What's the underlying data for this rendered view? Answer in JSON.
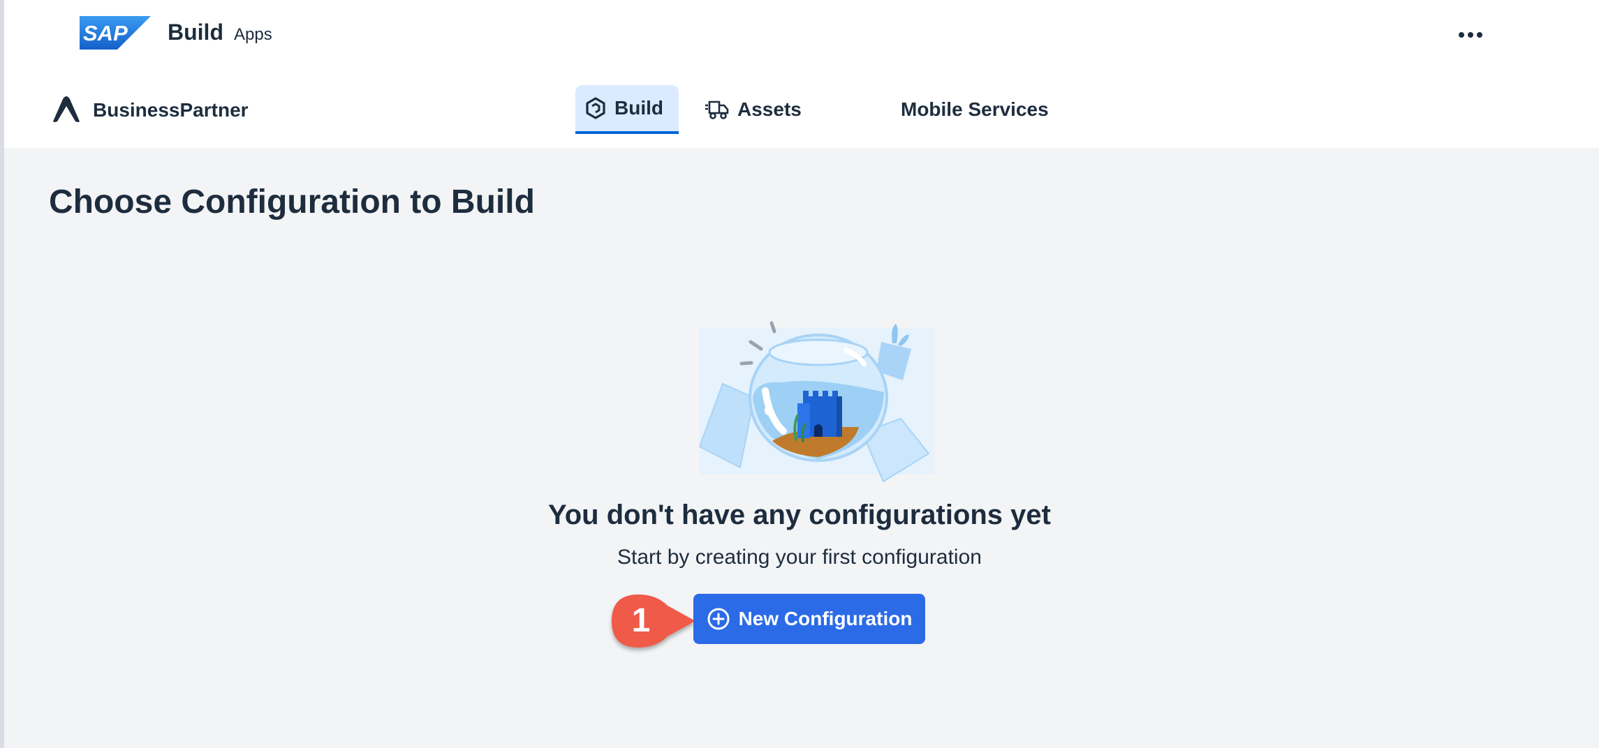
{
  "shell": {
    "logo_text": "SAP",
    "product_name": "Build",
    "product_sub": "Apps",
    "overflow_icon": "more-horizontal-icon"
  },
  "project": {
    "name": "BusinessPartner",
    "tabs": [
      {
        "label": "Build",
        "icon": "build-hexagon-icon",
        "selected": true
      },
      {
        "label": "Assets",
        "icon": "assets-truck-icon",
        "selected": false
      },
      {
        "label": "Mobile Services",
        "icon": "",
        "selected": false
      }
    ]
  },
  "main": {
    "title": "Choose Configuration to Build",
    "empty_state": {
      "title": "You don't have any configurations yet",
      "subtitle": "Start by creating your first configuration",
      "illustration": "fishbowl-castle-illustration"
    },
    "new_button": {
      "label": "New Configuration",
      "icon": "add-circle-icon"
    }
  },
  "annotation": {
    "step_number": "1"
  },
  "colors": {
    "accent": "#2b6be7",
    "selected_tab_bg": "#dbeaff",
    "selected_tab_underline": "#0064d9",
    "text": "#1d2d3e",
    "background": "#f3f4f6",
    "callout": "#f05a4a"
  }
}
